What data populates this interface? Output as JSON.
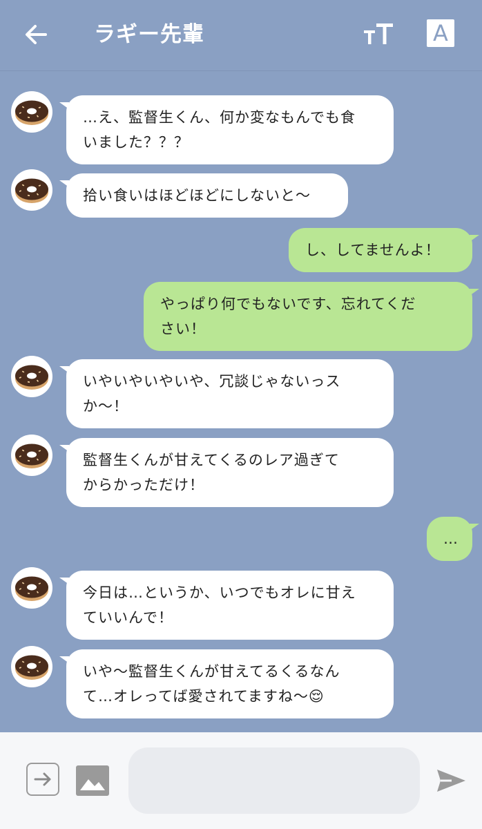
{
  "header": {
    "title": "ラギー先輩",
    "text_size_label": "TT",
    "translate_label": "A"
  },
  "messages": [
    {
      "side": "in",
      "lines": [
        "…え、監督生くん、何か変なもんでも食",
        "いました？？？"
      ]
    },
    {
      "side": "in",
      "lines": [
        "拾い食いはほどほどにしないと〜"
      ]
    },
    {
      "side": "out",
      "lines": [
        "し、してませんよ！"
      ]
    },
    {
      "side": "out",
      "lines": [
        "やっぱり何でもないです、忘れてくだ",
        "さい！"
      ]
    },
    {
      "side": "in",
      "lines": [
        "いやいやいやいや、冗談じゃないっス",
        "か〜！"
      ]
    },
    {
      "side": "in",
      "lines": [
        "監督生くんが甘えてくるのレア過ぎて",
        "からかっただけ！"
      ]
    },
    {
      "side": "out",
      "lines": [
        "…"
      ]
    },
    {
      "side": "in",
      "lines": [
        "今日は…というか、いつでもオレに甘え",
        "ていいんで！"
      ]
    },
    {
      "side": "in",
      "lines": [
        "いや〜監督生くんが甘えてるくるなん",
        "て…オレってば愛されてますね〜😌"
      ]
    }
  ],
  "input": {
    "value": "",
    "placeholder": ""
  },
  "icons": {
    "back": "back-arrow-icon",
    "text_size": "text-size-icon",
    "translate": "translate-icon",
    "avatar": "donut-avatar-icon",
    "share": "share-icon",
    "image": "image-icon",
    "send": "send-icon"
  },
  "colors": {
    "background": "#8aa0c3",
    "incoming_bubble": "#ffffff",
    "outgoing_bubble": "#b9e694",
    "footer": "#f6f7f9"
  }
}
